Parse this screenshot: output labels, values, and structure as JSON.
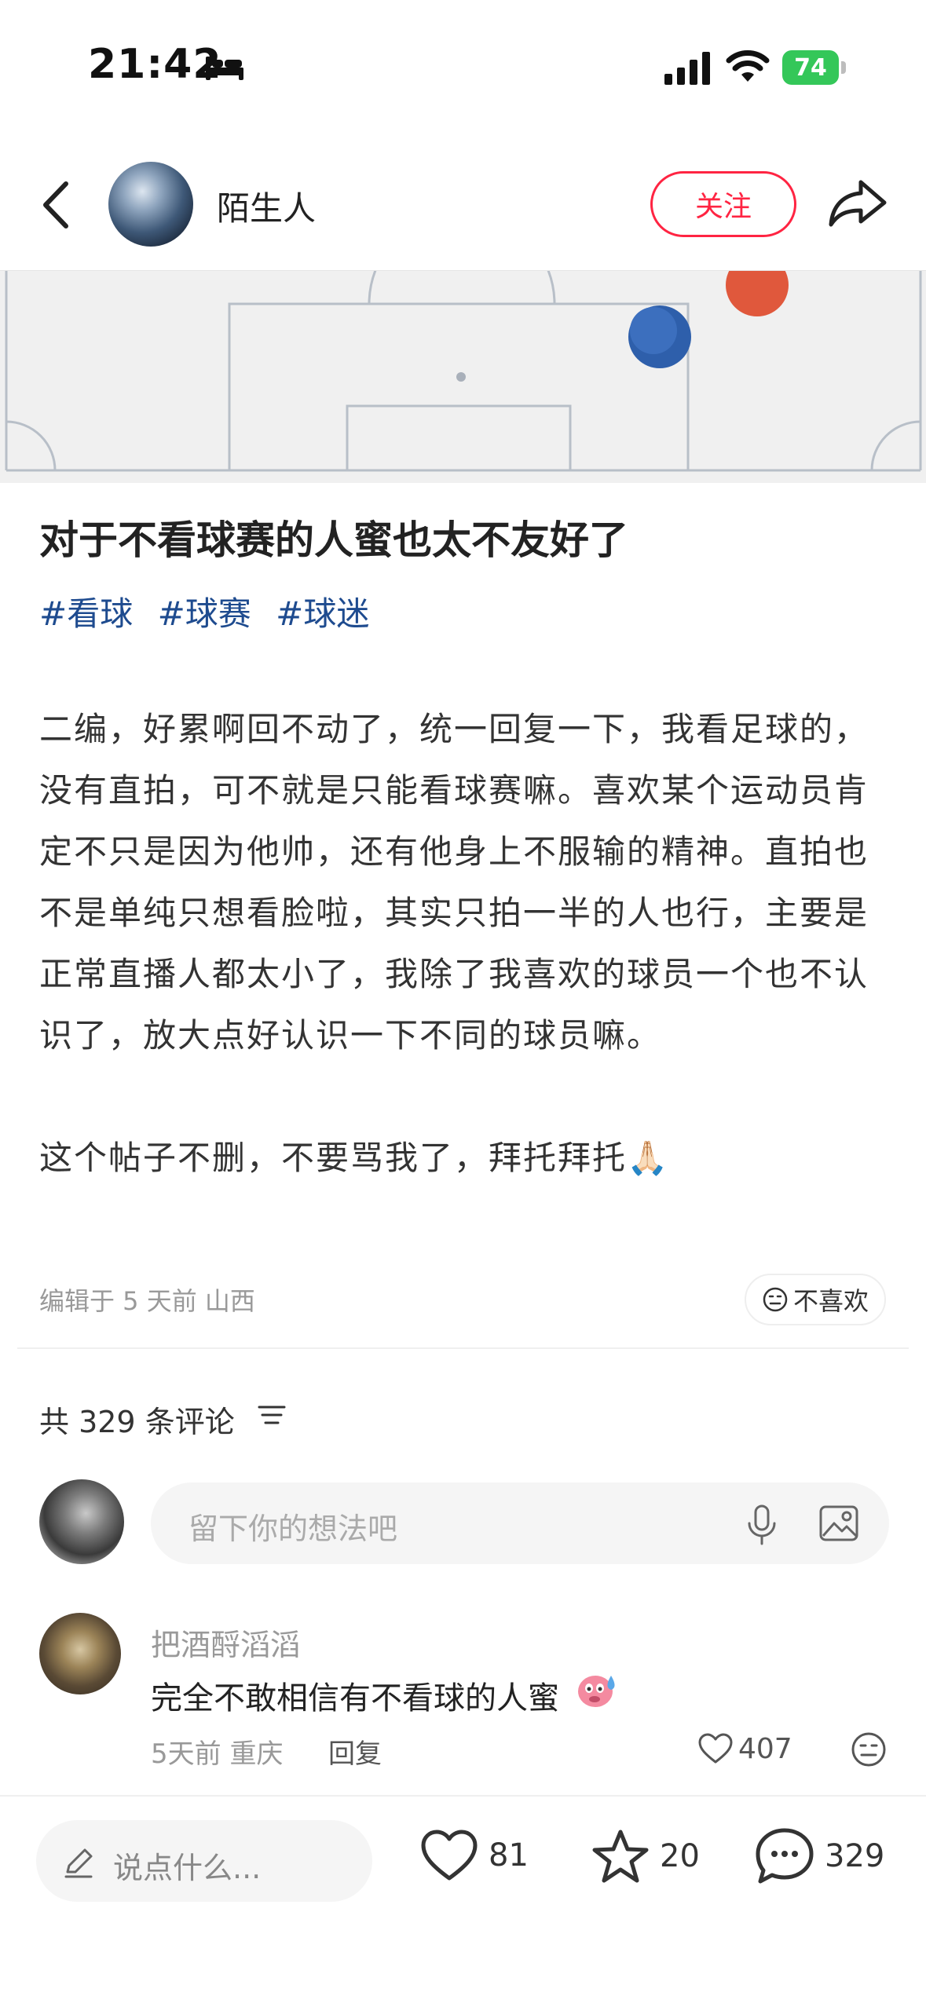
{
  "status_bar": {
    "time": "21:42",
    "battery": "74"
  },
  "header": {
    "author": "陌生人",
    "follow_label": "关注"
  },
  "post": {
    "title": "对于不看球赛的人蜜也太不友好了",
    "tags": [
      "#看球",
      "#球赛",
      "#球迷"
    ],
    "body": [
      "二编，好累啊回不动了，统一回复一下，我看足球的，没有直拍，可不就是只能看球赛嘛。喜欢某个运动员肯定不只是因为他帅，还有他身上不服输的精神。直拍也不是单纯只想看脸啦，其实只拍一半的人也行，主要是正常直播人都太小了，我除了我喜欢的球员一个也不认识了，放大点好认识一下不同的球员嘛。",
      "这个帖子不删，不要骂我了，拜托拜托🙏🏻"
    ],
    "meta": "编辑于 5 天前 山西",
    "dislike_label": "不喜欢"
  },
  "comments": {
    "count_label": "共 329 条评论",
    "input_placeholder": "留下你的想法吧",
    "items": [
      {
        "user": "把酒酹滔滔",
        "text": "完全不敢相信有不看球的人蜜",
        "meta": "5天前  重庆",
        "reply_label": "回复",
        "likes": "407"
      }
    ]
  },
  "bottom_bar": {
    "input_placeholder": "说点什么...",
    "likes": "81",
    "favorites": "20",
    "comments": "329"
  },
  "colors": {
    "accent": "#ff2442",
    "tag": "#1e4b8f",
    "battery": "#34c759"
  }
}
